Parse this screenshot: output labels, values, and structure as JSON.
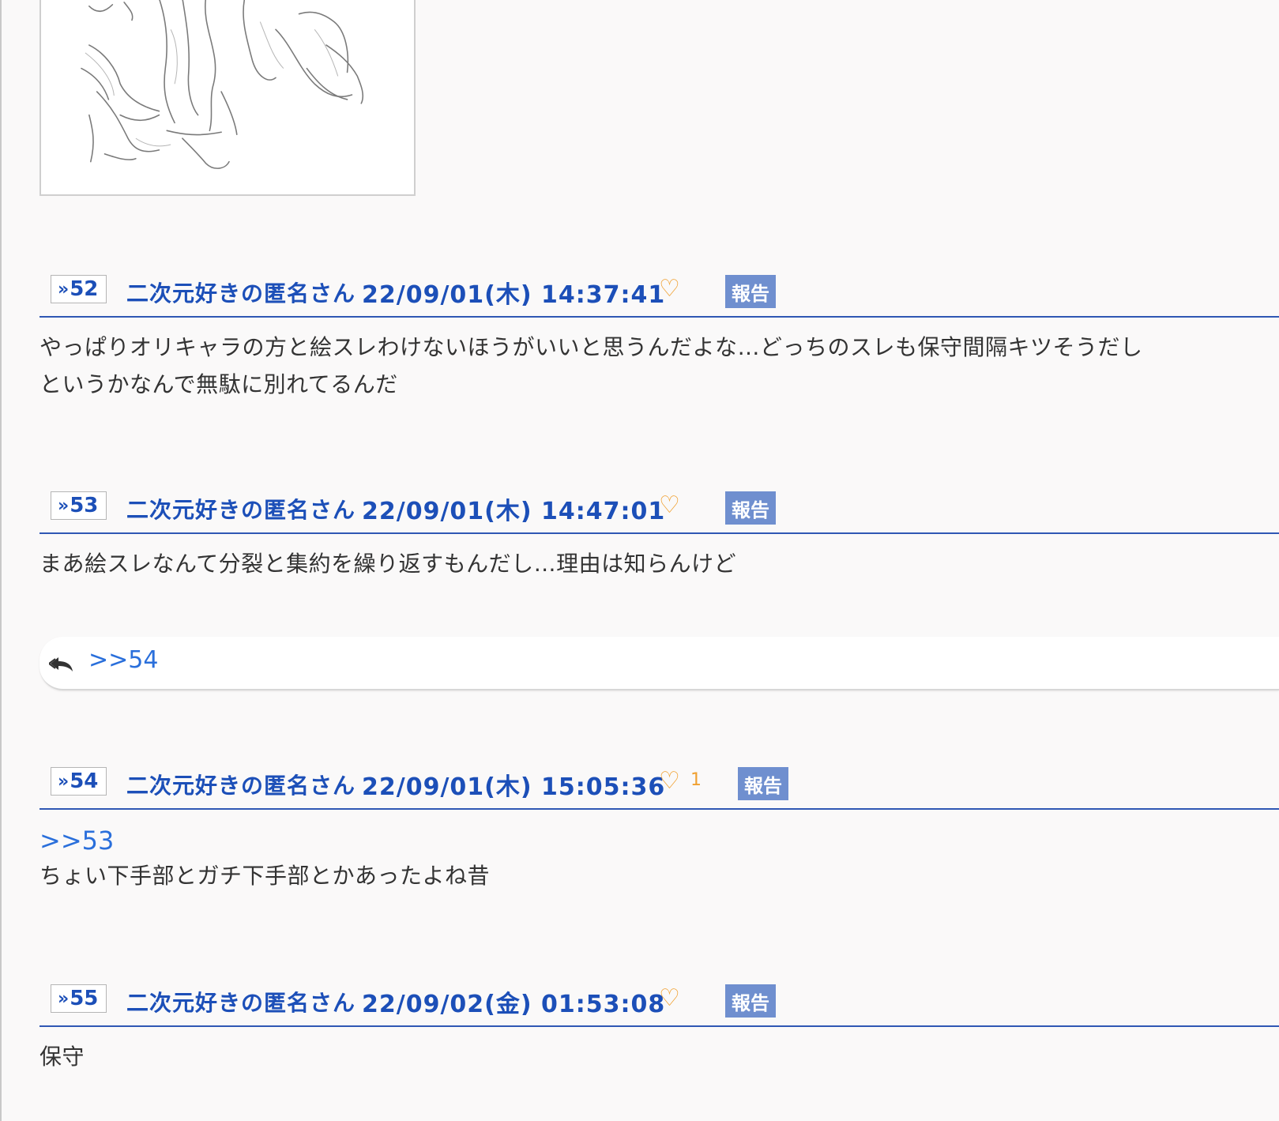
{
  "posts": [
    {
      "number": "52",
      "author": "二次元好きの匿名さん",
      "date": "22/09/01(木) 14:37:41",
      "likes": "",
      "report_label": "報告",
      "lines": [
        "やっぱりオリキャラの方と絵スレわけないほうがいいと思うんだよな…どっちのスレも保守間隔キツそうだし",
        "というかなんで無駄に別れてるんだ"
      ]
    },
    {
      "number": "53",
      "author": "二次元好きの匿名さん",
      "date": "22/09/01(木) 14:47:01",
      "likes": "",
      "report_label": "報告",
      "lines": [
        "まあ絵スレなんて分裂と集約を繰り返すもんだし…理由は知らんけど"
      ],
      "replies": [
        ">>54"
      ]
    },
    {
      "number": "54",
      "author": "二次元好きの匿名さん",
      "date": "22/09/01(木) 15:05:36",
      "likes": "1",
      "report_label": "報告",
      "quote": ">>53",
      "lines": [
        "ちょい下手部とガチ下手部とかあったよね昔"
      ]
    },
    {
      "number": "55",
      "author": "二次元好きの匿名さん",
      "date": "22/09/02(金) 01:53:08",
      "likes": "",
      "report_label": "報告",
      "lines": [
        "保守"
      ]
    }
  ],
  "icons": {
    "post_number": "double-chevron-right-icon",
    "like": "heart-outline-icon",
    "reply": "reply-arrow-icon"
  },
  "colors": {
    "accent": "#1c4fb8",
    "link": "#2a6fdb",
    "heart": "#f0a030",
    "report_bg": "#6f8fcf"
  }
}
